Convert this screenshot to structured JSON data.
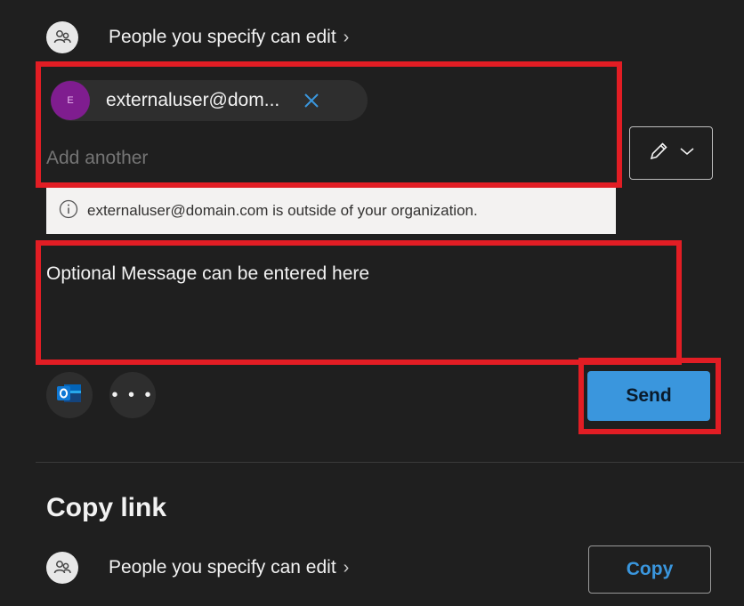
{
  "share": {
    "permission_label": "People you specify can edit",
    "chevron": "›",
    "recipient": {
      "avatar_letter": "E",
      "email": "externaluser@dom...",
      "avatar_color": "#7f1d8f"
    },
    "add_another_placeholder": "Add another",
    "warning_text": "externaluser@domain.com is outside of your organization.",
    "message_placeholder": "Optional Message can be entered here",
    "more_label": "• • •",
    "send_label": "Send"
  },
  "copy_link": {
    "heading": "Copy link",
    "permission_label": "People you specify can edit",
    "chevron": "›",
    "copy_label": "Copy"
  },
  "colors": {
    "background": "#1f1f1f",
    "accent": "#3a96dd",
    "highlight": "#e21d24"
  },
  "icons": [
    "people-icon",
    "close-icon",
    "pencil-icon",
    "chevron-down-icon",
    "info-icon",
    "outlook-icon",
    "more-icon"
  ]
}
